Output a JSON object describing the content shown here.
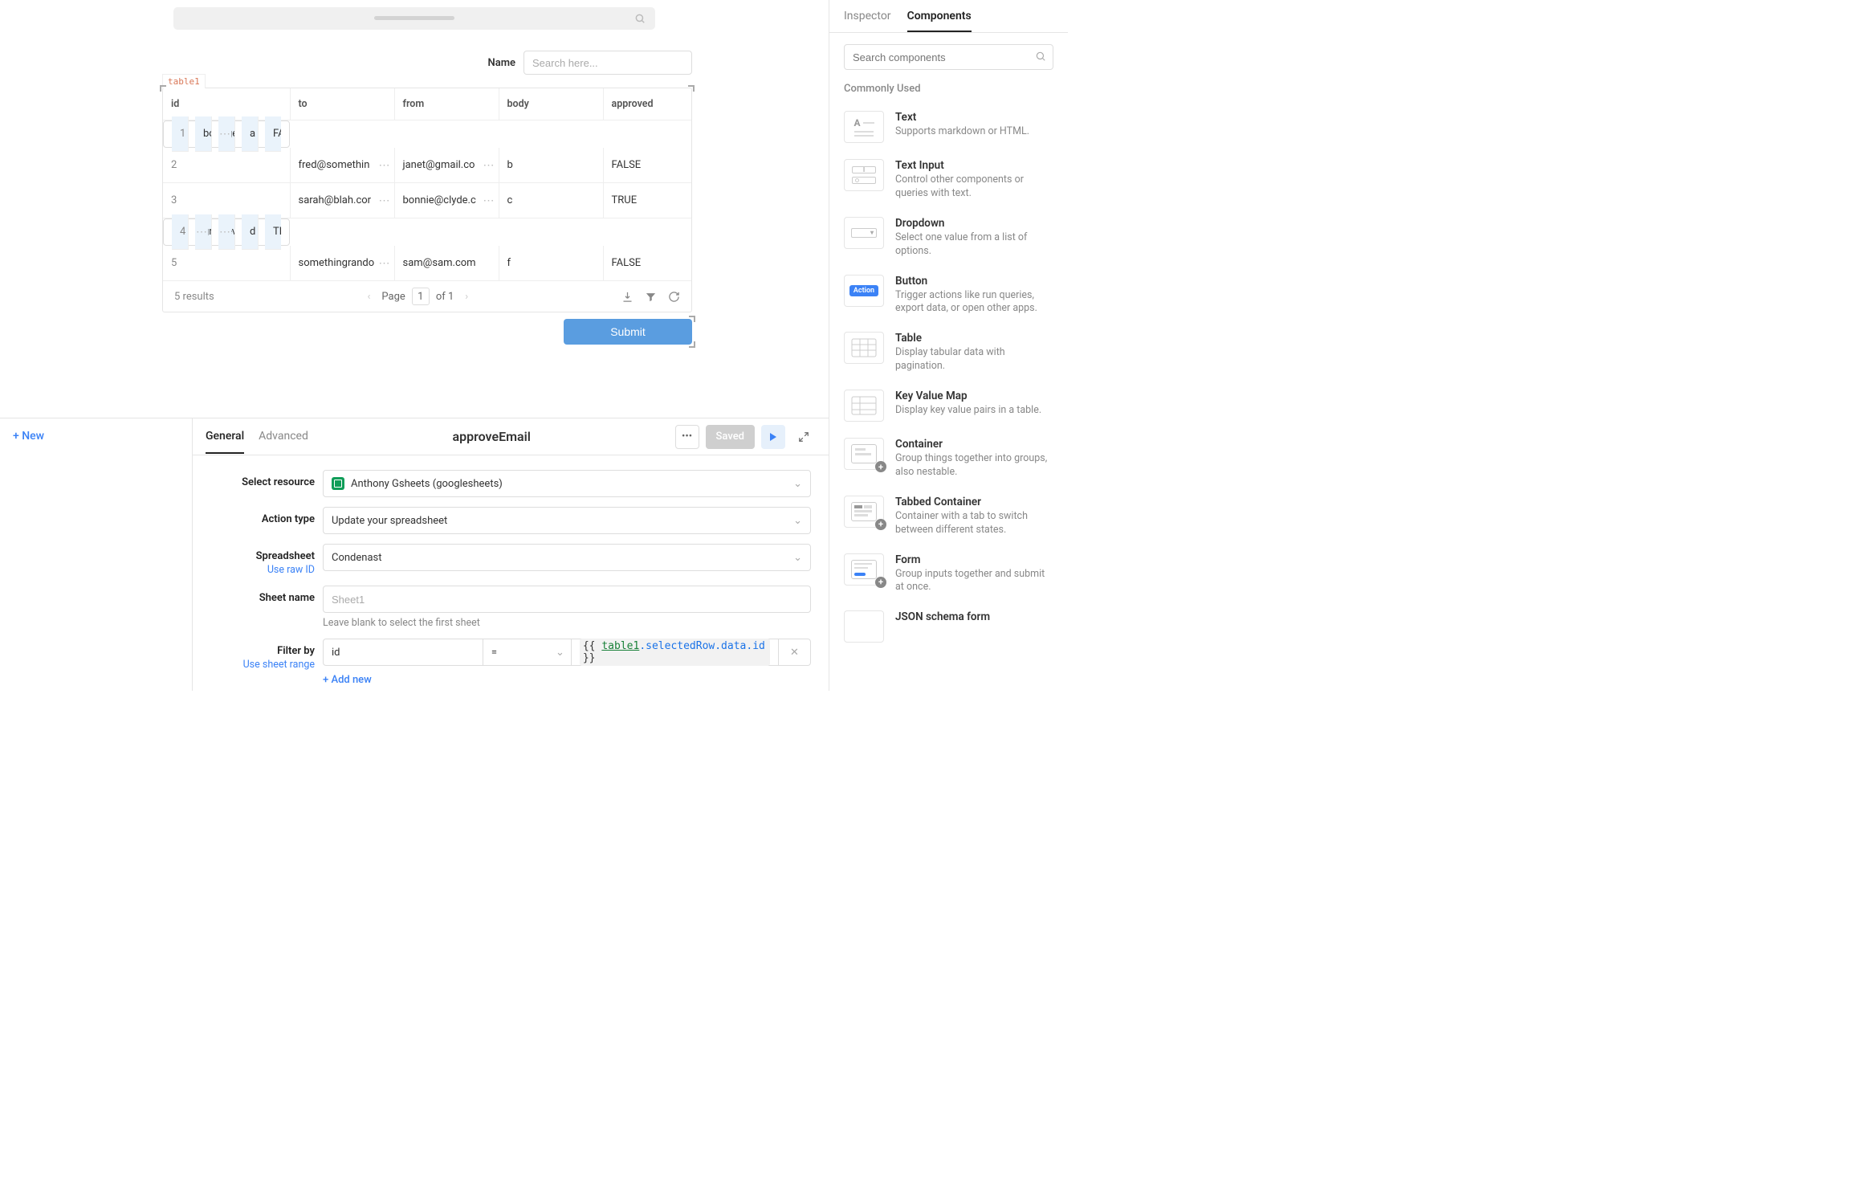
{
  "topbar": {
    "search_placeholder": ""
  },
  "canvas": {
    "name_label": "Name",
    "name_placeholder": "Search here...",
    "table_tag": "table1",
    "columns": [
      "id",
      "to",
      "from",
      "body",
      "approved"
    ],
    "rows": [
      {
        "id": "1",
        "to": "bob@condenas",
        "from": "george@gmail.c",
        "body": "a",
        "approved": "FALSE",
        "sel": true
      },
      {
        "id": "2",
        "to": "fred@somethin",
        "from": "janet@gmail.co",
        "body": "b",
        "approved": "FALSE",
        "sel": false
      },
      {
        "id": "3",
        "to": "sarah@blah.cor",
        "from": "bonnie@clyde.c",
        "body": "c",
        "approved": "TRUE",
        "sel": false
      },
      {
        "id": "4",
        "to": "gretta@gmail.co",
        "from": "evalu@tor.com",
        "body": "d",
        "approved": "TRUE",
        "sel": true
      },
      {
        "id": "5",
        "to": "somethingrando",
        "from": "sam@sam.com",
        "body": "f",
        "approved": "FALSE",
        "sel": false
      }
    ],
    "results": "5 results",
    "page_label": "Page",
    "page_num": "1",
    "page_of": "of 1",
    "submit_label": "Submit"
  },
  "panel": {
    "new_label": "+ New",
    "tabs": {
      "general": "General",
      "advanced": "Advanced"
    },
    "title": "approveEmail",
    "saved_label": "Saved",
    "resource_label": "Select resource",
    "resource_value": "Anthony Gsheets (googlesheets)",
    "action_label": "Action type",
    "action_value": "Update your spreadsheet",
    "spreadsheet_label": "Spreadsheet",
    "spreadsheet_sub": "Use raw ID",
    "spreadsheet_value": "Condenast",
    "sheet_label": "Sheet name",
    "sheet_placeholder": "Sheet1",
    "sheet_hint": "Leave blank to select the first sheet",
    "filter_label": "Filter by",
    "filter_sub": "Use sheet range",
    "filter_col": "id",
    "filter_op": "=",
    "filter_expr_open": "{{ ",
    "filter_expr_table": "table1",
    "filter_expr_rest": ".selectedRow.data.id",
    "filter_expr_close": " }}",
    "addnew": "+ Add new"
  },
  "rightbar": {
    "tabs": {
      "inspector": "Inspector",
      "components": "Components"
    },
    "search_placeholder": "Search components",
    "heading": "Commonly Used",
    "components": [
      {
        "title": "Text",
        "desc": "Supports markdown or HTML.",
        "icon": "text"
      },
      {
        "title": "Text Input",
        "desc": "Control other components or queries with text.",
        "icon": "textinput"
      },
      {
        "title": "Dropdown",
        "desc": "Select one value from a list of options.",
        "icon": "dropdown"
      },
      {
        "title": "Button",
        "desc": "Trigger actions like run queries, export data, or open other apps.",
        "icon": "button"
      },
      {
        "title": "Table",
        "desc": "Display tabular data with pagination.",
        "icon": "table"
      },
      {
        "title": "Key Value Map",
        "desc": "Display key value pairs in a table.",
        "icon": "kvmap"
      },
      {
        "title": "Container",
        "desc": "Group things together into groups, also nestable.",
        "icon": "container"
      },
      {
        "title": "Tabbed Container",
        "desc": "Container with a tab to switch between different states.",
        "icon": "tabbed"
      },
      {
        "title": "Form",
        "desc": "Group inputs together and submit at once.",
        "icon": "form"
      },
      {
        "title": "JSON schema form",
        "desc": "",
        "icon": "json"
      }
    ]
  }
}
